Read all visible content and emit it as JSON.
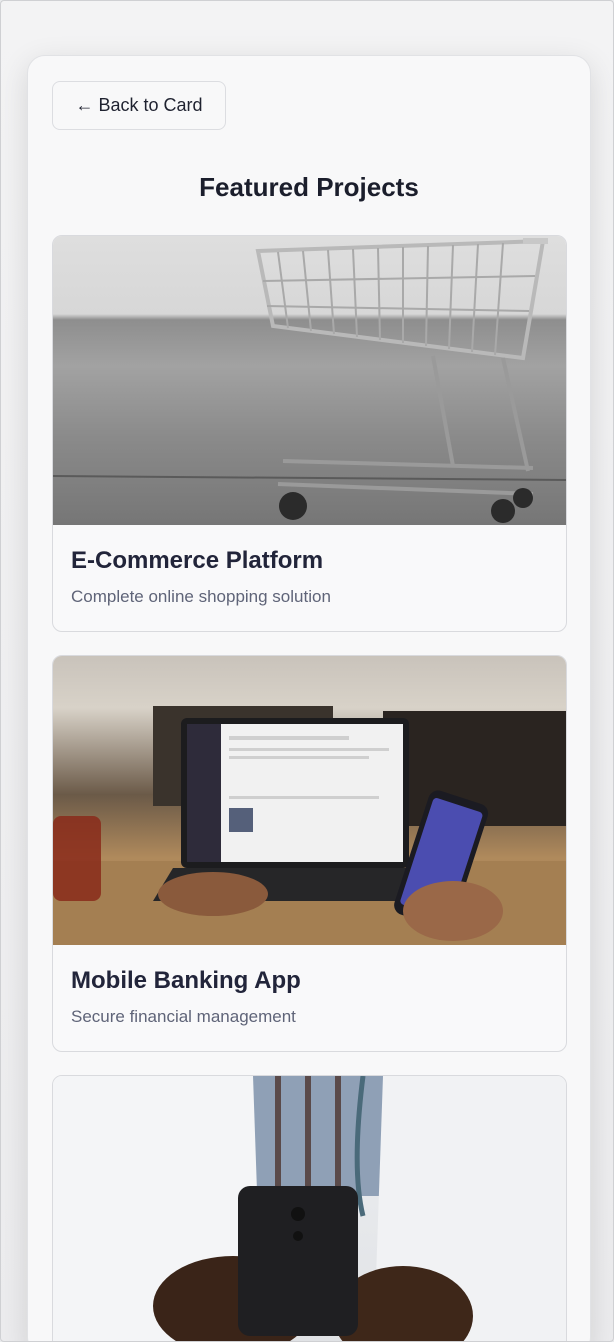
{
  "back_button": {
    "label": "← Back to Card"
  },
  "page": {
    "title": "Featured Projects"
  },
  "projects": [
    {
      "title": "E-Commerce Platform",
      "description": "Complete online shopping solution",
      "image_icon": "shopping-cart-photo"
    },
    {
      "title": "Mobile Banking App",
      "description": "Secure financial management",
      "image_icon": "laptop-and-phone-photo"
    },
    {
      "title": "",
      "description": "",
      "image_icon": "doctor-with-phone-photo"
    }
  ]
}
